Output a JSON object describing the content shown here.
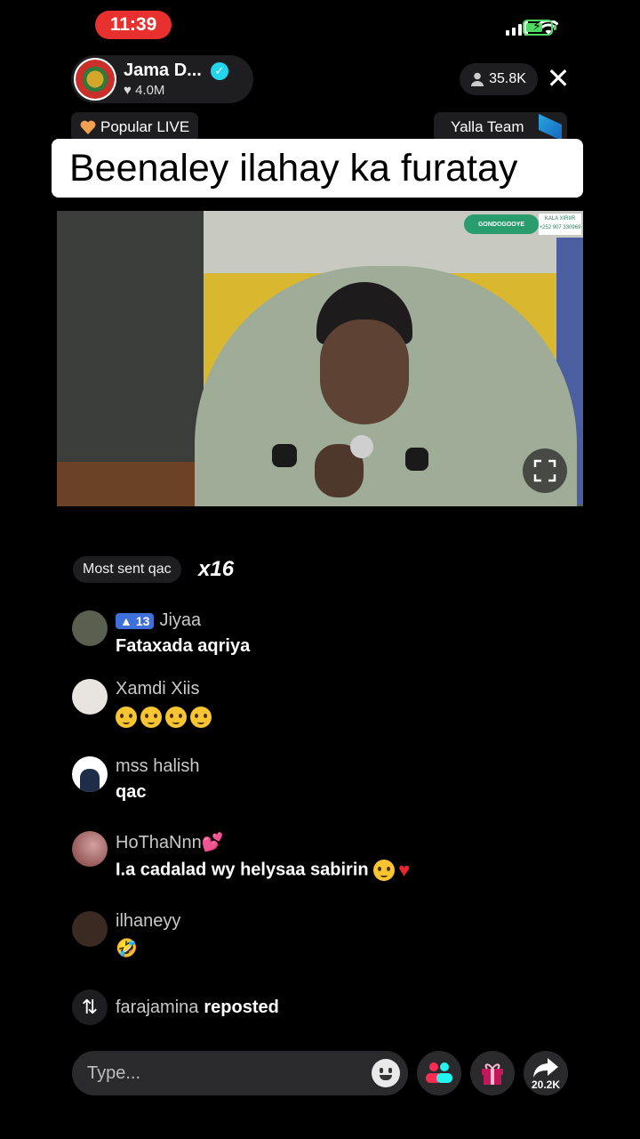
{
  "status_bar": {
    "time": "11:39"
  },
  "host": {
    "name": "Jama D...",
    "likes": "4.0M",
    "avatar_icon": "emblem-avatar-icon"
  },
  "viewers": {
    "count": "35.8K"
  },
  "tags": {
    "popular": "Popular LIVE",
    "team": "Yalla Team"
  },
  "banner": {
    "text": "Beenaley ilahay ka furatay"
  },
  "video": {
    "logo_text": "GONDOGOOYE",
    "contact_text": "KALA XIRIIR +252 907 330969"
  },
  "gift_summary": {
    "label": "Most sent qac",
    "multiplier": "x16"
  },
  "comments": [
    {
      "user": "Jiyaa",
      "level": "13",
      "text": "Fataxada aqriya",
      "avatar_color": "#5a5f4f"
    },
    {
      "user": "Xamdi Xiis",
      "text": "",
      "emoji_count": 4,
      "avatar_color": "#e8e4e0"
    },
    {
      "user": "mss halish",
      "text": "qac",
      "avatar_color": "#ffffff"
    },
    {
      "user": "HoThaNnn💕",
      "text": "I.a cadalad wy helysaa sabirin",
      "avatar_color": "#7a3a3a"
    },
    {
      "user": "ilhaneyy",
      "text": "🤣",
      "avatar_color": "#3a2a22"
    }
  ],
  "repost": {
    "user": "farajamina",
    "action": "reposted"
  },
  "bottom_bar": {
    "placeholder": "Type...",
    "share_count": "20.2K"
  },
  "colors": {
    "accent_red": "#e8312f",
    "verified": "#20d5ec",
    "level_badge": "#3f6fd8",
    "battery": "#4cd964"
  }
}
